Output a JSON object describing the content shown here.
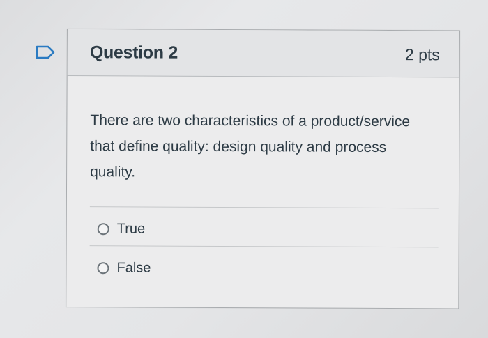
{
  "question": {
    "title": "Question 2",
    "points": "2 pts",
    "text": "There are two characteristics of a product/service that define quality: design quality and process quality.",
    "answers": [
      {
        "label": "True",
        "selected": false
      },
      {
        "label": "False",
        "selected": false
      }
    ]
  },
  "icons": {
    "flag": "bookmark-flag-icon"
  },
  "colors": {
    "flag_stroke": "#2b7bc2",
    "text": "#2d3b45",
    "card_bg": "#ececed",
    "header_bg": "#e3e4e6"
  }
}
